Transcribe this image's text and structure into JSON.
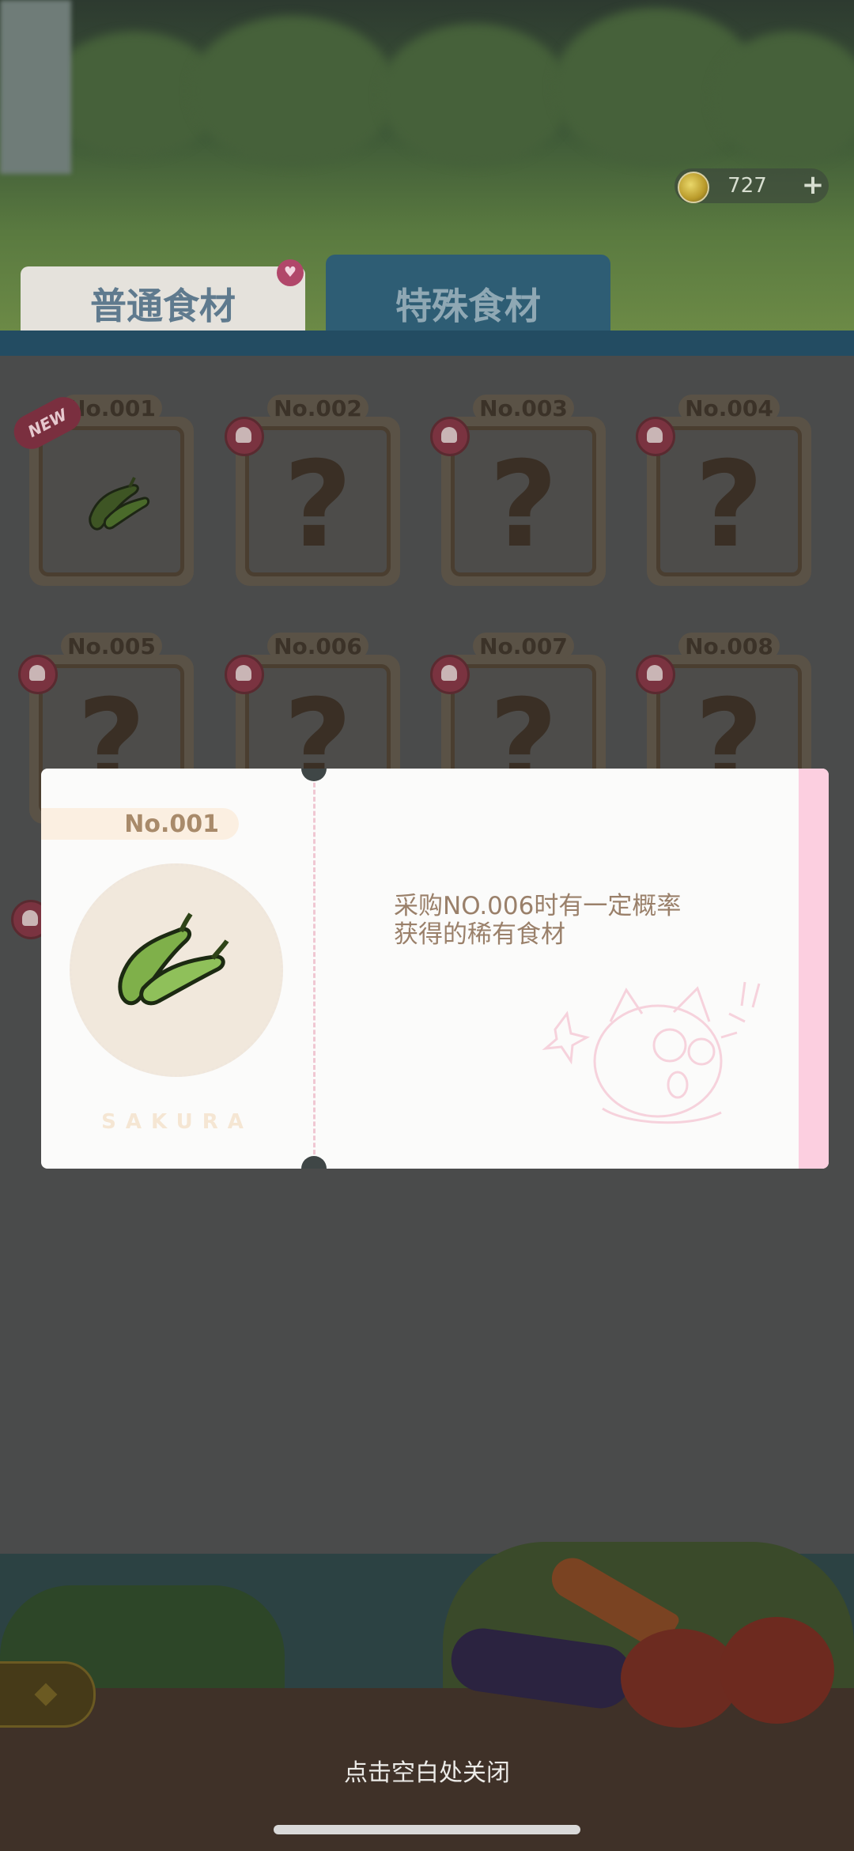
{
  "header": {
    "currency": {
      "icon": "coin-icon",
      "value": "727",
      "add_label": "+"
    }
  },
  "tabs": [
    {
      "label": "普通食材",
      "active": false,
      "badge_icon": "heart-icon"
    },
    {
      "label": "特殊食材",
      "active": true
    }
  ],
  "grid": {
    "items": [
      {
        "number": "No.001",
        "is_new": true,
        "new_label": "NEW",
        "unlocked": true,
        "icon": "green-pepper-icon"
      },
      {
        "number": "No.002",
        "unlocked": false,
        "placeholder": "?"
      },
      {
        "number": "No.003",
        "unlocked": false,
        "placeholder": "?"
      },
      {
        "number": "No.004",
        "unlocked": false,
        "placeholder": "?"
      },
      {
        "number": "No.005",
        "unlocked": false,
        "placeholder": "?"
      },
      {
        "number": "No.006",
        "unlocked": false,
        "placeholder": "?"
      },
      {
        "number": "No.007",
        "unlocked": false,
        "placeholder": "?"
      },
      {
        "number": "No.008",
        "unlocked": false,
        "placeholder": "?"
      }
    ]
  },
  "popup": {
    "number": "No.001",
    "item_icon": "green-pepper-icon",
    "brand": "SAKURA",
    "description_line1": "采购NO.006时有一定概率",
    "description_line2": "获得的稀有食材"
  },
  "footer": {
    "back_icon": "back-arrow-icon",
    "close_hint": "点击空白处关闭"
  },
  "colors": {
    "popup_accent": "#fccfe0",
    "tab_active": "#2e5d74",
    "text_brown": "#9a806a"
  }
}
